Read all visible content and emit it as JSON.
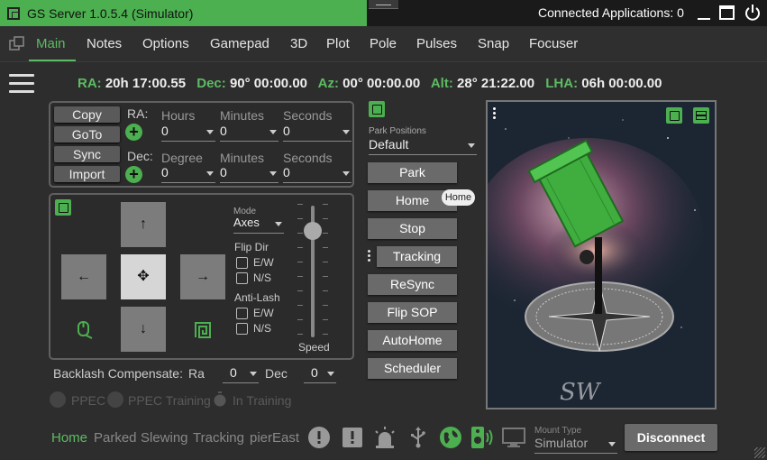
{
  "window": {
    "title": "GS Server  1.0.5.4  (Simulator)",
    "connected_apps": "Connected Applications: 0"
  },
  "menu": {
    "tabs": [
      "Main",
      "Notes",
      "Options",
      "Gamepad",
      "3D",
      "Plot",
      "Pole",
      "Pulses",
      "Snap",
      "Focuser"
    ]
  },
  "coords": {
    "ra_label": "RA:",
    "ra_value": "20h 17:00.55",
    "dec_label": "Dec:",
    "dec_value": "90° 00:00.00",
    "az_label": "Az:",
    "az_value": "00° 00:00.00",
    "alt_label": "Alt:",
    "alt_value": "28° 21:22.00",
    "lha_label": "LHA:",
    "lha_value": "06h 00:00.00"
  },
  "goto_panel": {
    "buttons": [
      "Copy",
      "GoTo",
      "Sync",
      "Import"
    ],
    "ra_label": "RA:",
    "dec_label": "Dec:",
    "ra_fields": [
      {
        "label": "Hours",
        "value": "0"
      },
      {
        "label": "Minutes",
        "value": "0"
      },
      {
        "label": "Seconds",
        "value": "0"
      }
    ],
    "dec_fields": [
      {
        "label": "Degree",
        "value": "0"
      },
      {
        "label": "Minutes",
        "value": "0"
      },
      {
        "label": "Seconds",
        "value": "0"
      }
    ]
  },
  "hand_panel": {
    "arrows": {
      "up": "↑",
      "down": "↓",
      "left": "←",
      "right": "→",
      "center": "✥"
    },
    "mode_label": "Mode",
    "mode_value": "Axes",
    "flip_dir_label": "Flip Dir",
    "flip_ew": "E/W",
    "flip_ns": "N/S",
    "antilash_label": "Anti-Lash",
    "antilash_ew": "E/W",
    "antilash_ns": "N/S",
    "speed_label": "Speed",
    "speed_level": 0.15
  },
  "backlash": {
    "label": "Backlash Compensate:",
    "ra_label": "Ra",
    "ra_value": "0",
    "dec_label": "Dec",
    "dec_value": "0"
  },
  "ppec": {
    "ppec": "PPEC",
    "ppec_training": "PPEC Training",
    "in_training": "In Training"
  },
  "park": {
    "label": "Park Positions",
    "value": "Default"
  },
  "side_buttons": [
    "Park",
    "Home",
    "Stop",
    "Tracking",
    "ReSync",
    "Flip SOP",
    "AutoHome",
    "Scheduler"
  ],
  "home_tooltip": "Home",
  "status": {
    "home": "Home",
    "parked": "Parked",
    "slewing": "Slewing",
    "tracking": "Tracking",
    "pier": "pierEast"
  },
  "mount_type": {
    "label": "Mount Type",
    "value": "Simulator"
  },
  "disconnect": "Disconnect",
  "colors": {
    "accent": "#4caf50",
    "text": "#dddddd",
    "bg": "#2d2d2d"
  }
}
